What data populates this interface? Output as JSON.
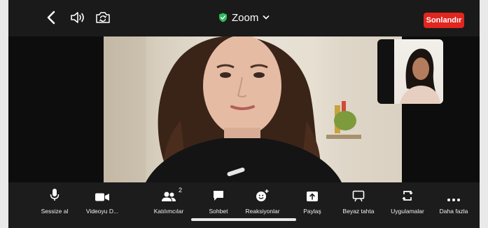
{
  "header": {
    "title": "Zoom",
    "end_button_label": "Sonlandır",
    "icons": [
      "back-chevron-icon",
      "speaker-icon",
      "camera-switch-icon",
      "shield-check-icon",
      "chevron-down-icon"
    ]
  },
  "video": {
    "participants_count": "2"
  },
  "toolbar": {
    "items": [
      {
        "label": "Sessize al",
        "icon": "microphone-icon"
      },
      {
        "label": "Videoyu D...",
        "icon": "video-camera-icon"
      },
      {
        "label": "Katılımcılar",
        "icon": "participants-icon"
      },
      {
        "label": "Sohbet",
        "icon": "chat-icon"
      },
      {
        "label": "Reaksiyonlar",
        "icon": "reactions-icon"
      },
      {
        "label": "Paylaş",
        "icon": "share-icon"
      },
      {
        "label": "Beyaz tahta",
        "icon": "whiteboard-icon"
      },
      {
        "label": "Uygulamalar",
        "icon": "apps-icon"
      },
      {
        "label": "Daha fazla",
        "icon": "more-icon"
      }
    ]
  },
  "colors": {
    "end_button": "#e0261f",
    "secure_shield": "#2dbb5e",
    "toolbar_bg": "#1c1c1c"
  }
}
